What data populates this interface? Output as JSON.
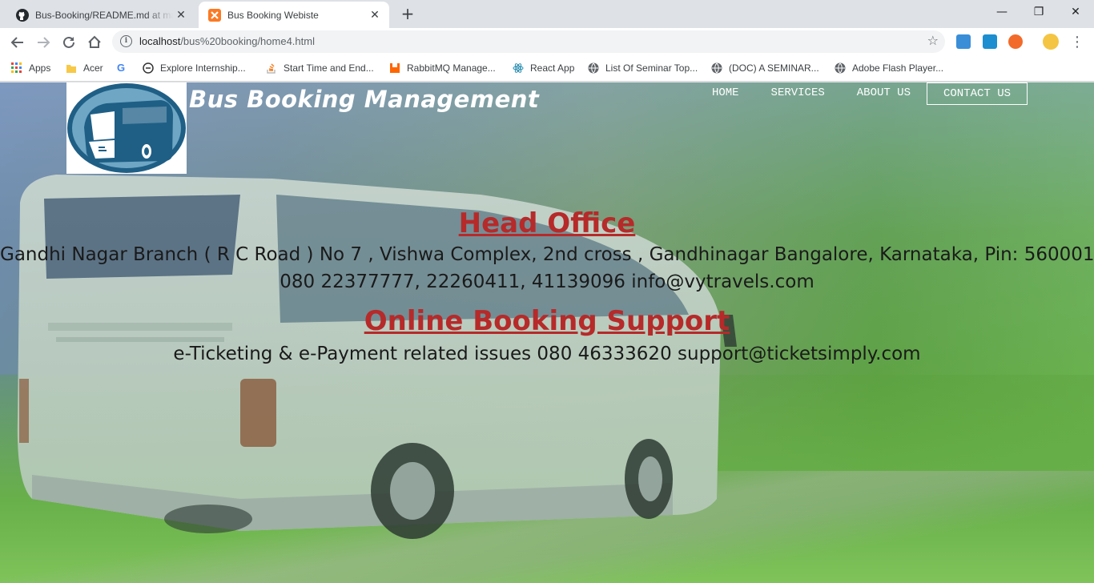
{
  "browser": {
    "tabs": [
      {
        "title": "Bus-Booking/README.md at master",
        "active": false
      },
      {
        "title": "Bus Booking Webiste",
        "active": true
      }
    ],
    "url": {
      "host": "localhost",
      "path": "/bus%20booking/home4.html"
    },
    "bookmarks": [
      {
        "label": "Apps",
        "icon": "apps-grid-icon"
      },
      {
        "label": "Acer",
        "icon": "folder-icon"
      },
      {
        "label": "",
        "icon": "google-icon"
      },
      {
        "label": "Explore Internship...",
        "icon": "site-icon"
      },
      {
        "label": "Start Time and End...",
        "icon": "stackoverflow-icon"
      },
      {
        "label": "RabbitMQ Manage...",
        "icon": "rabbitmq-icon"
      },
      {
        "label": "React App",
        "icon": "react-icon"
      },
      {
        "label": "List Of Seminar Top...",
        "icon": "globe-icon"
      },
      {
        "label": "(DOC) A SEMINAR...",
        "icon": "globe-icon"
      },
      {
        "label": "Adobe Flash Player...",
        "icon": "globe-icon"
      }
    ]
  },
  "site": {
    "brand": "Bus Booking Management",
    "nav": [
      {
        "label": "HOME"
      },
      {
        "label": "SERVICES"
      },
      {
        "label": "ABOUT US"
      },
      {
        "label": "CONTACT US",
        "active": true
      }
    ],
    "head_office": {
      "heading": "Head Office",
      "address": "Gandhi Nagar Branch ( R C Road ) No 7 , Vishwa Complex, 2nd cross , Gandhinagar Bangalore, Karnataka, Pin: 560001",
      "contact": "080 22377777, 22260411, 41139096 info@vytravels.com"
    },
    "online_support": {
      "heading": "Online Booking Support",
      "contact": "e-Ticketing & e-Payment related issues 080 46333620 support@ticketsimply.com"
    }
  },
  "colors": {
    "heading": "#b62a2a",
    "tab_strip": "#dee1e6",
    "logo_blue": "#1f5f86"
  }
}
